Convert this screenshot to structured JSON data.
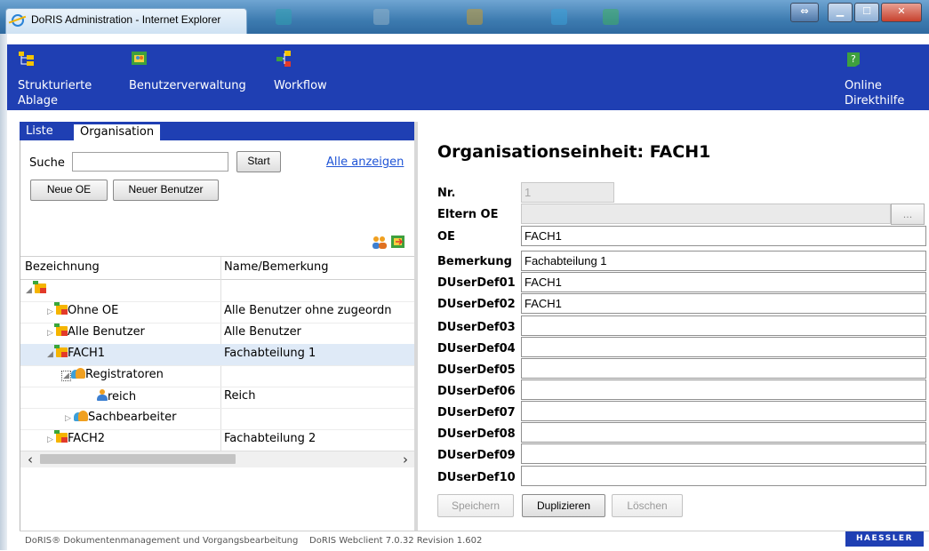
{
  "window": {
    "title": "DoRIS Administration - Internet Explorer"
  },
  "nav": [
    {
      "label": "Strukturierte\nAblage",
      "icon": "tree-icon"
    },
    {
      "label": "Benutzerverwaltung",
      "icon": "users-icon"
    },
    {
      "label": "Workflow",
      "icon": "workflow-icon"
    },
    {
      "label": "Online\nDirekthilfe",
      "icon": "help-icon"
    }
  ],
  "left": {
    "tabs": [
      "Liste",
      "Organisation"
    ],
    "search_label": "Suche",
    "search_value": "",
    "start_button": "Start",
    "show_all_link": "Alle anzeigen",
    "new_oe_button": "Neue OE",
    "new_user_button": "Neuer Benutzer",
    "columns": [
      "Bezeichnung",
      "Name/Bemerkung"
    ],
    "rows": [
      {
        "label": "",
        "note": ""
      },
      {
        "label": "Ohne OE",
        "note": "Alle Benutzer ohne zugeordn"
      },
      {
        "label": "Alle Benutzer",
        "note": "Alle Benutzer"
      },
      {
        "label": "FACH1",
        "note": "Fachabteilung 1"
      },
      {
        "label": "Registratoren",
        "note": ""
      },
      {
        "label": "reich",
        "note": "Reich"
      },
      {
        "label": "Sachbearbeiter",
        "note": ""
      },
      {
        "label": "FACH2",
        "note": "Fachabteilung 2"
      }
    ]
  },
  "form": {
    "title": "Organisationseinheit: FACH1",
    "fields": [
      {
        "label": "Nr.",
        "value": "1"
      },
      {
        "label": "Eltern OE",
        "value": ""
      },
      {
        "label": "OE",
        "value": "FACH1"
      },
      {
        "label": "Bemerkung",
        "value": "Fachabteilung 1"
      },
      {
        "label": "DUserDef01",
        "value": "FACH1"
      },
      {
        "label": "DUserDef02",
        "value": "FACH1"
      },
      {
        "label": "DUserDef03",
        "value": ""
      },
      {
        "label": "DUserDef04",
        "value": ""
      },
      {
        "label": "DUserDef05",
        "value": ""
      },
      {
        "label": "DUserDef06",
        "value": ""
      },
      {
        "label": "DUserDef07",
        "value": ""
      },
      {
        "label": "DUserDef08",
        "value": ""
      },
      {
        "label": "DUserDef09",
        "value": ""
      },
      {
        "label": "DUserDef10",
        "value": ""
      }
    ],
    "ellipsis": "...",
    "save_button": "Speichern",
    "duplicate_button": "Duplizieren",
    "delete_button": "Löschen"
  },
  "footer": {
    "text": "DoRIS® Dokumentenmanagement und Vorgangsbearbeitung    DoRIS Webclient 7.0.32 Revision 1.602",
    "brand": "HAESSLER"
  },
  "colors": {
    "nav_bg": "#1f3fb3",
    "selected_row": "#dfeaf7",
    "link": "#1f54d6"
  }
}
